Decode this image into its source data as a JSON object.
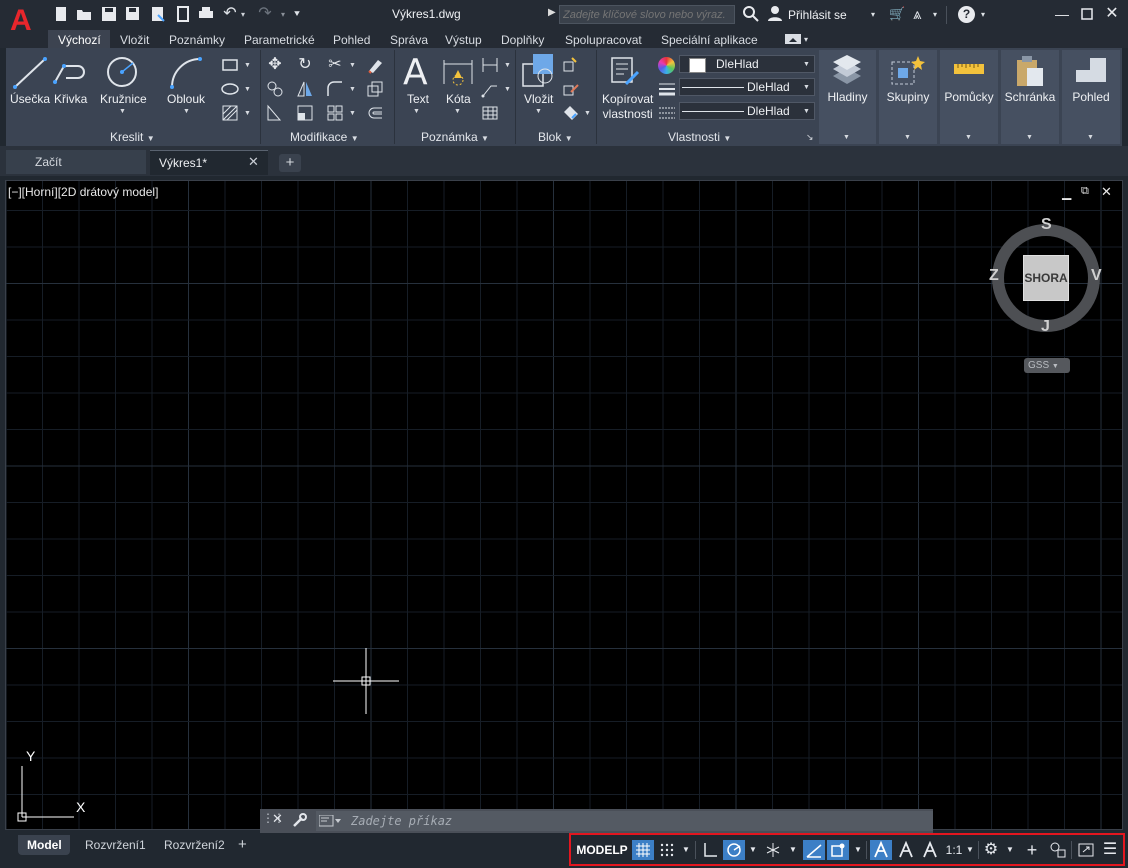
{
  "window": {
    "document_title": "Výkres1.dwg",
    "search_placeholder": "Zadejte klíčové slovo nebo výraz.",
    "signin_label": "Přihlásit se"
  },
  "ribbon_tabs": [
    "Výchozí",
    "Vložit",
    "Poznámky",
    "Parametrické",
    "Pohled",
    "Správa",
    "Výstup",
    "Doplňky",
    "Spolupracovat",
    "Speciální aplikace"
  ],
  "ribbon": {
    "draw": {
      "panel_title": "Kreslit",
      "line": "Úsečka",
      "polyline": "Křivka",
      "circle": "Kružnice",
      "arc": "Oblouk"
    },
    "modify": {
      "panel_title": "Modifikace"
    },
    "annotation": {
      "panel_title": "Poznámka",
      "text": "Text",
      "dimension": "Kóta"
    },
    "block": {
      "panel_title": "Blok",
      "insert": "Vložit"
    },
    "properties": {
      "panel_title": "Vlastnosti",
      "match_line1": "Kopírovat",
      "match_line2": "vlastnosti",
      "color_value": "DleHlad",
      "linetype_value": "DleHlad",
      "lineweight_value": "DleHlad"
    },
    "right_buttons": [
      "Hladiny",
      "Skupiny",
      "Pomůcky",
      "Schránka",
      "Pohled"
    ]
  },
  "file_tabs": {
    "start": "Začít",
    "drawing": "Výkres1*"
  },
  "viewport": {
    "label": "[−][Horní][2D drátový model]",
    "viewcube": {
      "face": "SHORA",
      "north": "S",
      "south": "J",
      "east": "V",
      "west": "Z",
      "ucs_menu": "GSS"
    },
    "ucs_x": "X",
    "ucs_y": "Y"
  },
  "command_line": {
    "placeholder": "Zadejte příkaz"
  },
  "layout_tabs": [
    "Model",
    "Rozvržení1",
    "Rozvržení2"
  ],
  "status_bar": {
    "model_label": "MODELP",
    "scale": "1:1"
  },
  "colors": {
    "accent": "#3c7fc6",
    "logo_red": "#e8262c",
    "highlight": "#e3161f",
    "canvas": "#000000"
  }
}
